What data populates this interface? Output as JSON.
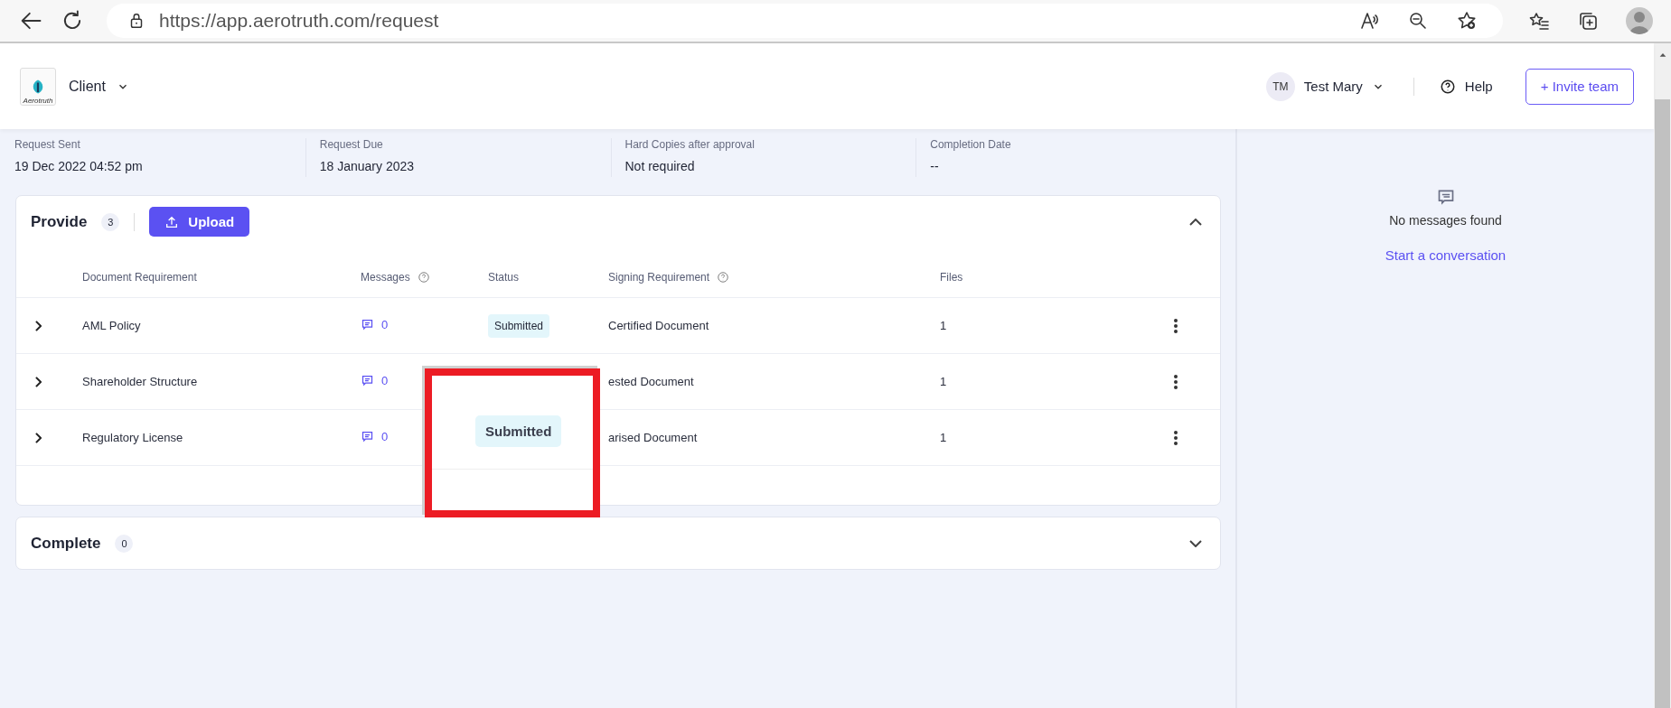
{
  "browser": {
    "url": "https://app.aerotruth.com/request"
  },
  "header": {
    "logo_text": "Aerotruth",
    "workspace": "Client",
    "user_initials": "TM",
    "user_name": "Test Mary",
    "help": "Help",
    "invite": "+ Invite team"
  },
  "info": [
    {
      "label": "Request Sent",
      "value": "19 Dec 2022 04:52 pm"
    },
    {
      "label": "Request Due",
      "value": "18 January 2023"
    },
    {
      "label": "Hard Copies after approval",
      "value": "Not required"
    },
    {
      "label": "Completion Date",
      "value": "--"
    }
  ],
  "sections": [
    {
      "title": "Provide",
      "count": "3",
      "expanded": true,
      "upload": "Upload",
      "columns": [
        {
          "label": "Document Requirement",
          "help": false
        },
        {
          "label": "Messages",
          "help": true
        },
        {
          "label": "Status",
          "help": false
        },
        {
          "label": "Signing Requirement",
          "help": true
        },
        {
          "label": "Files",
          "help": false
        }
      ],
      "rows": [
        {
          "expanded": false,
          "name": "AML Policy",
          "messages": "0",
          "status": "Submitted",
          "signing": "Certified Document",
          "files": "1"
        },
        {
          "expanded": false,
          "name": "Shareholder Structure",
          "messages": "0",
          "signing": "ested Document",
          "files": "1"
        },
        {
          "expanded": false,
          "name": "Regulatory License",
          "messages": "0",
          "signing": "arised Document",
          "files": "1"
        }
      ]
    },
    {
      "title": "Complete",
      "count": "0",
      "expanded": false
    }
  ],
  "chat": {
    "empty": "No messages found",
    "action": "Start a conversation"
  },
  "callout": {
    "label": "Submitted"
  }
}
